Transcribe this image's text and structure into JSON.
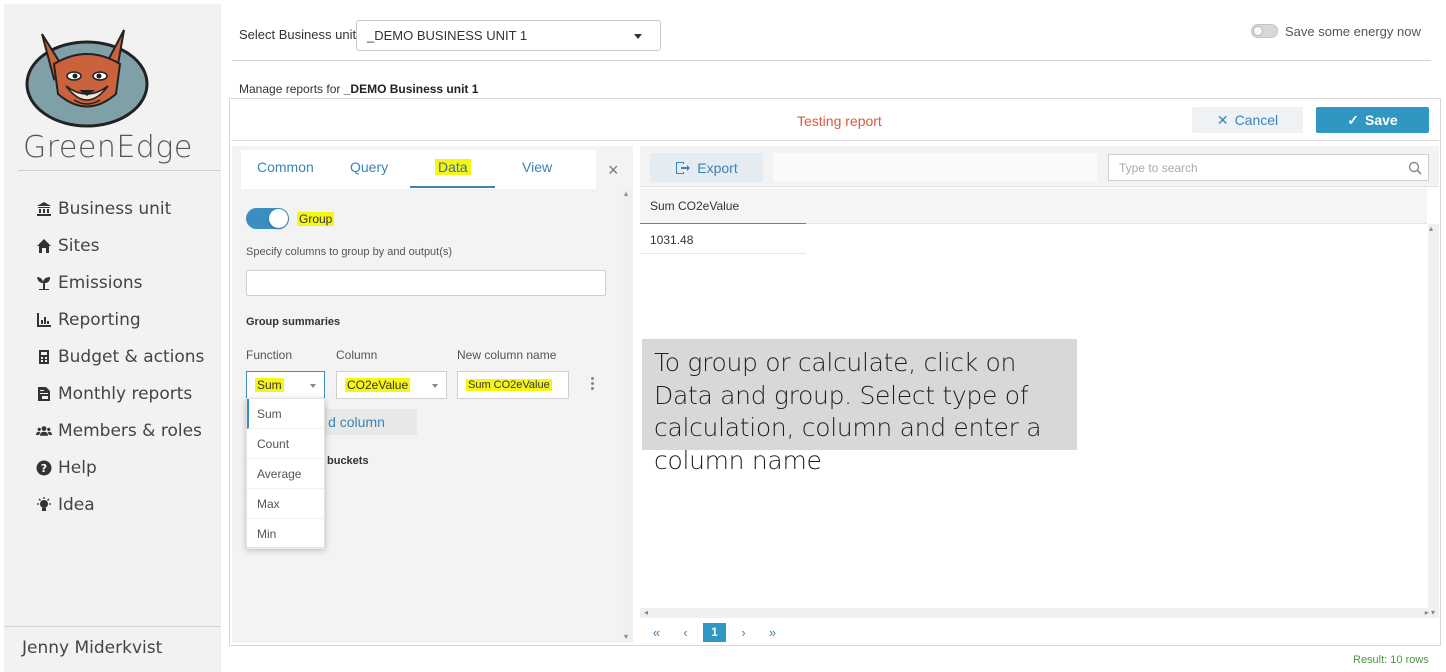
{
  "app": {
    "brand": "GreenEdge",
    "user": "Jenny Miderkvist"
  },
  "sidebar": {
    "items": [
      {
        "label": "Business unit",
        "icon": "bank-icon"
      },
      {
        "label": "Sites",
        "icon": "home-icon"
      },
      {
        "label": "Emissions",
        "icon": "seedling-icon"
      },
      {
        "label": "Reporting",
        "icon": "chart-icon"
      },
      {
        "label": "Budget & actions",
        "icon": "calculator-icon"
      },
      {
        "label": "Monthly reports",
        "icon": "file-invoice-icon"
      },
      {
        "label": "Members & roles",
        "icon": "users-icon"
      },
      {
        "label": "Help",
        "icon": "question-circle-icon"
      },
      {
        "label": "Idea",
        "icon": "lightbulb-icon"
      }
    ]
  },
  "topbar": {
    "bu_label": "Select Business unit:",
    "bu_value": "_DEMO BUSINESS UNIT 1",
    "energy_label": "Save some energy now",
    "manage_prefix": "Manage reports for",
    "manage_unit": "_DEMO Business unit 1"
  },
  "report": {
    "title": "Testing report",
    "cancel": "Cancel",
    "save": "Save"
  },
  "config": {
    "tabs": [
      "Common",
      "Query",
      "Data",
      "View"
    ],
    "active_tab": "Data",
    "group_label": "Group",
    "spec_label": "Specify columns to group by and output(s)",
    "group_summaries": "Group summaries",
    "headers": {
      "function": "Function",
      "column": "Column",
      "new_column": "New column name"
    },
    "function_value": "Sum",
    "column_value": "CO2eValue",
    "new_column_value": "Sum CO2eValue",
    "add_column": "d column",
    "buckets": "buckets",
    "function_options": [
      "Sum",
      "Count",
      "Average",
      "Max",
      "Min"
    ]
  },
  "grid": {
    "export": "Export",
    "search_placeholder": "Type to search",
    "column_header": "Sum CO2eValue",
    "rows": [
      "1031.48"
    ],
    "pager": {
      "first": "«",
      "prev": "‹",
      "page": "1",
      "next": "›",
      "last": "»"
    },
    "result": "Result: 10 rows"
  },
  "callout": "To group or calculate, click on Data and group. Select type of calculation, column and enter a column name",
  "colors": {
    "accent": "#2f97c1",
    "title_red": "#d9593d",
    "highlight": "#f5f516",
    "result_green": "#4a9a3f"
  }
}
